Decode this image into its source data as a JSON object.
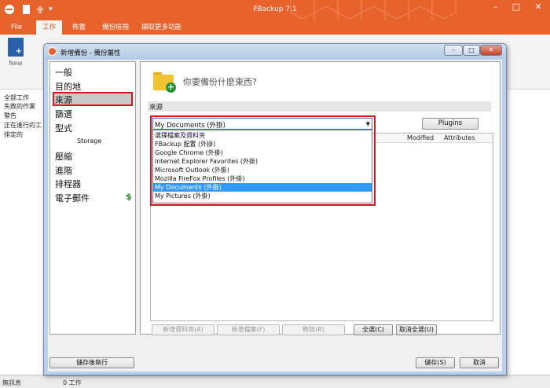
{
  "app": {
    "title": "FBackup 7.1",
    "menu_tabs": [
      "File",
      "工作",
      "佈置",
      "備份檢視",
      "擷取更多功能"
    ],
    "new_button_label": "New",
    "left_list": [
      "全部工作",
      "失敗的作業",
      "警告",
      "正在進行的工",
      "排定的"
    ],
    "status": {
      "left": "無訊息",
      "right": "0 工作"
    },
    "colors": {
      "brand_orange": "#e8622c"
    }
  },
  "dialog": {
    "title": "新增備份 - 備份屬性",
    "nav": {
      "items": [
        "一般",
        "目的地",
        "來源",
        "篩選",
        "型式",
        "Storage",
        "壓縮",
        "進階",
        "排程器",
        "電子郵件"
      ],
      "selected": "來源"
    },
    "question": "你要備份什麼東西?",
    "section_label": "來源",
    "combo": {
      "value": "My Documents (外掛)",
      "options": [
        "選擇檔案及資料夾",
        "FBackup 配置 (外掛)",
        "Google Chrome (外掛)",
        "Internet Explorer Favorites (外掛)",
        "Microsoft Outlook (外掛)",
        "Mozilla FireFox Profiles (外掛)",
        "My Documents (外掛)",
        "My Pictures (外掛)"
      ]
    },
    "plugins_button": "Plugins",
    "columns": [
      "Modified",
      "Attributes"
    ],
    "buttons": {
      "add_folder": "新增資料夾(A)",
      "add_file": "新增檔案(F)",
      "remove": "移除(R)",
      "select_all": "全選(C)",
      "deselect_all": "取消全選(U)",
      "save_and_run": "儲存後執行",
      "save": "儲存(S)",
      "cancel": "取消"
    },
    "window_controls": [
      "minimize-icon",
      "maximize-icon",
      "close-icon"
    ]
  }
}
